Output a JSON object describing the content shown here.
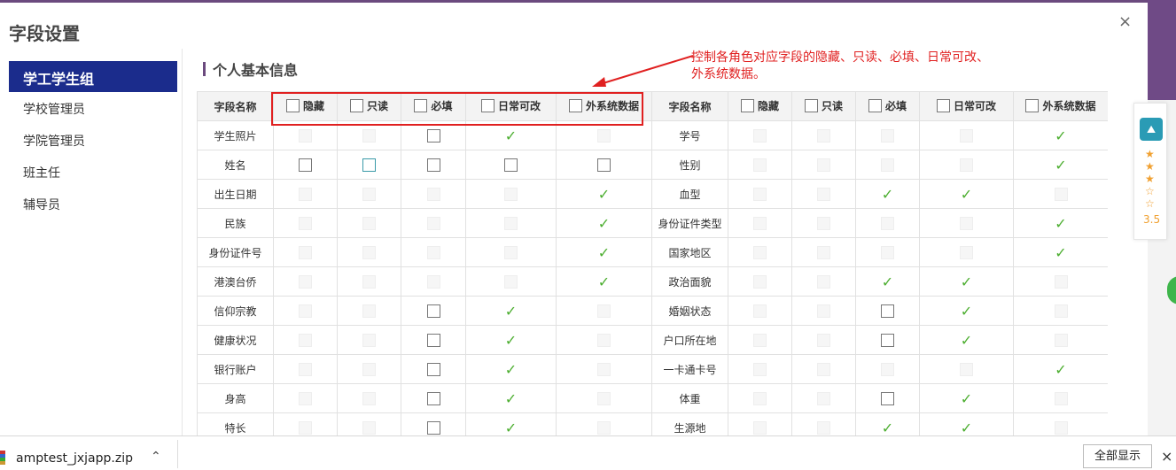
{
  "dialog": {
    "title": "字段设置",
    "close": "×"
  },
  "nav": {
    "active": "学工学生组",
    "items": [
      "学校管理员",
      "学院管理员",
      "班主任",
      "辅导员"
    ]
  },
  "section": {
    "title": "个人基本信息"
  },
  "annotation": {
    "line1": "控制各角色对应字段的隐藏、只读、必填、日常可改、",
    "line2": "外系统数据。"
  },
  "table": {
    "headers": [
      "字段名称",
      "隐藏",
      "只读",
      "必填",
      "日常可改",
      "外系统数据",
      "字段名称",
      "隐藏",
      "只读",
      "必填",
      "日常可改",
      "外系统数据"
    ],
    "rows": [
      {
        "left": {
          "name": "学生照片",
          "cells": [
            "d",
            "d",
            "e",
            "c",
            "d"
          ]
        },
        "right": {
          "name": "学号",
          "cells": [
            "d",
            "d",
            "d",
            "d",
            "c"
          ]
        }
      },
      {
        "left": {
          "name": "姓名",
          "cells": [
            "e",
            "f",
            "e",
            "e",
            "e"
          ]
        },
        "right": {
          "name": "性别",
          "cells": [
            "d",
            "d",
            "d",
            "d",
            "c"
          ]
        }
      },
      {
        "left": {
          "name": "出生日期",
          "cells": [
            "d",
            "d",
            "d",
            "d",
            "c"
          ]
        },
        "right": {
          "name": "血型",
          "cells": [
            "d",
            "d",
            "c",
            "c",
            "d"
          ]
        }
      },
      {
        "left": {
          "name": "民族",
          "cells": [
            "d",
            "d",
            "d",
            "d",
            "c"
          ]
        },
        "right": {
          "name": "身份证件类型",
          "cells": [
            "d",
            "d",
            "d",
            "d",
            "c"
          ]
        }
      },
      {
        "left": {
          "name": "身份证件号",
          "cells": [
            "d",
            "d",
            "d",
            "d",
            "c"
          ]
        },
        "right": {
          "name": "国家地区",
          "cells": [
            "d",
            "d",
            "d",
            "d",
            "c"
          ]
        }
      },
      {
        "left": {
          "name": "港澳台侨",
          "cells": [
            "d",
            "d",
            "d",
            "d",
            "c"
          ]
        },
        "right": {
          "name": "政治面貌",
          "cells": [
            "d",
            "d",
            "c",
            "c",
            "d"
          ]
        }
      },
      {
        "left": {
          "name": "信仰宗教",
          "cells": [
            "d",
            "d",
            "e",
            "c",
            "d"
          ]
        },
        "right": {
          "name": "婚姻状态",
          "cells": [
            "d",
            "d",
            "e",
            "c",
            "d"
          ]
        }
      },
      {
        "left": {
          "name": "健康状况",
          "cells": [
            "d",
            "d",
            "e",
            "c",
            "d"
          ]
        },
        "right": {
          "name": "户口所在地",
          "cells": [
            "d",
            "d",
            "e",
            "c",
            "d"
          ]
        }
      },
      {
        "left": {
          "name": "银行账户",
          "cells": [
            "d",
            "d",
            "e",
            "c",
            "d"
          ]
        },
        "right": {
          "name": "一卡通卡号",
          "cells": [
            "d",
            "d",
            "d",
            "d",
            "c"
          ]
        }
      },
      {
        "left": {
          "name": "身高",
          "cells": [
            "d",
            "d",
            "e",
            "c",
            "d"
          ]
        },
        "right": {
          "name": "体重",
          "cells": [
            "d",
            "d",
            "e",
            "c",
            "d"
          ]
        }
      },
      {
        "left": {
          "name": "特长",
          "cells": [
            "d",
            "d",
            "e",
            "c",
            "d"
          ]
        },
        "right": {
          "name": "生源地",
          "cells": [
            "d",
            "d",
            "c",
            "c",
            "d"
          ]
        }
      }
    ]
  },
  "rating": {
    "score": "3.5",
    "logo": "⛰"
  },
  "download_bar": {
    "filename": "amptest_jxjapp.zip",
    "show_all": "全部显示",
    "close": "×",
    "chevron": "⌃"
  },
  "icons": {
    "checkmark": "✓",
    "star_full": "★",
    "star_empty": "☆"
  },
  "colors": {
    "nav_active": "#1b2c8c",
    "check": "#4cae30",
    "annotation": "#e02020",
    "accent": "#6b4a7e"
  }
}
